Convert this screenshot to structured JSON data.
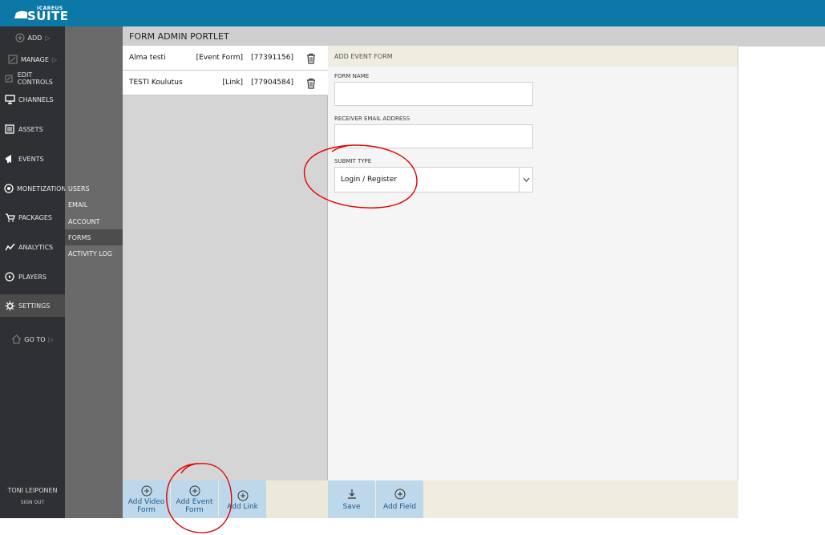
{
  "brand": {
    "small": "ICAREUS",
    "big": "SUITE"
  },
  "nav": {
    "add": "ADD",
    "manage": "MANAGE",
    "edit_controls": "EDIT CONTROLS",
    "channels": "CHANNELS",
    "assets": "ASSETS",
    "events": "EVENTS",
    "monetization": "MONETIZATION",
    "packages": "PACKAGES",
    "analytics": "ANALYTICS",
    "players": "PLAYERS",
    "settings": "SETTINGS",
    "goto": "GO TO"
  },
  "subnav": {
    "users": "USERS",
    "email": "EMAIL",
    "account": "ACCOUNT",
    "forms": "FORMS",
    "activity_log": "ACTIVITY LOG"
  },
  "user": {
    "name": "TONI LEIPONEN",
    "signout": "SIGN OUT"
  },
  "portlet": {
    "title": "FORM ADMIN PORTLET"
  },
  "forms": [
    {
      "name": "Alma testi",
      "type": "[Event Form]",
      "id": "[77391156]"
    },
    {
      "name": "TESTI Koulutus",
      "type": "[Link]",
      "id": "[77904584]"
    }
  ],
  "left_actions": {
    "add_video_form_1": "Add Video",
    "add_video_form_2": "Form",
    "add_event_form_1": "Add Event",
    "add_event_form_2": "Form",
    "add_link": "Add Link"
  },
  "editor": {
    "header": "ADD EVENT FORM",
    "form_name_label": "FORM NAME",
    "form_name_value": "",
    "receiver_email_label": "RECEIVER EMAIL ADDRESS",
    "receiver_email_value": "",
    "submit_type_label": "SUBMIT TYPE",
    "submit_type_value": "Login / Register"
  },
  "right_actions": {
    "save": "Save",
    "add_field": "Add Field"
  },
  "colors": {
    "topbar": "#0b78a8",
    "nav_bg": "#2e3033",
    "subnav_bg": "#6a6a6a",
    "button_bg": "#bcd8ea",
    "annotation": "#e00000"
  }
}
